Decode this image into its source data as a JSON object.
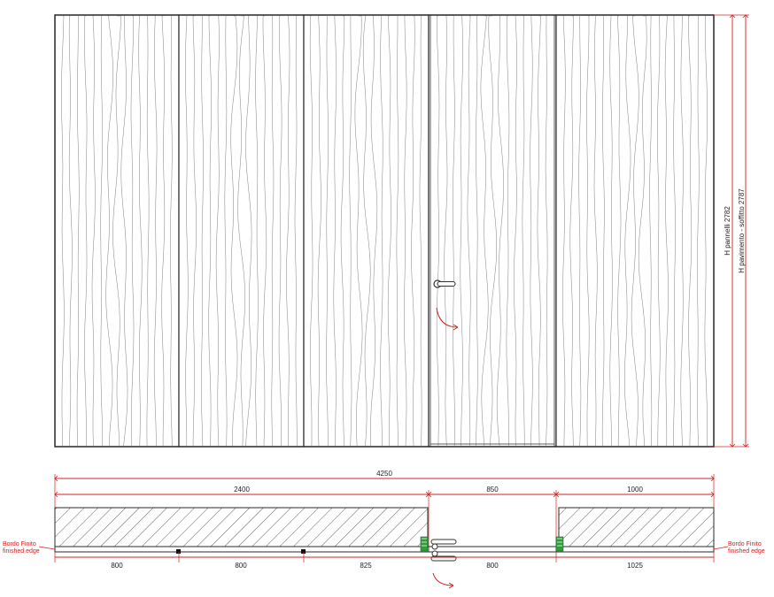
{
  "elevation": {
    "height_panels_label": "H pannelli 2782",
    "height_floor_ceiling_label": "H pavimento - soffitto 2787"
  },
  "plan": {
    "total_width": "4250",
    "top_dimensions": [
      "2400",
      "850",
      "1000"
    ],
    "bottom_dimensions": [
      "800",
      "800",
      "825",
      "800",
      "1025"
    ],
    "edge_label_left": [
      "Bordo Finito",
      "finished edge"
    ],
    "edge_label_right": [
      "Bordo Finito",
      "finished edge"
    ]
  },
  "colors": {
    "dimension_red": "#d42020",
    "hinge_green": "#2f9e3a",
    "outline": "#2a2a2a"
  },
  "icons": {
    "door_handle": "lever-handle-icon",
    "opening_arrow": "swing-arrow-icon"
  }
}
